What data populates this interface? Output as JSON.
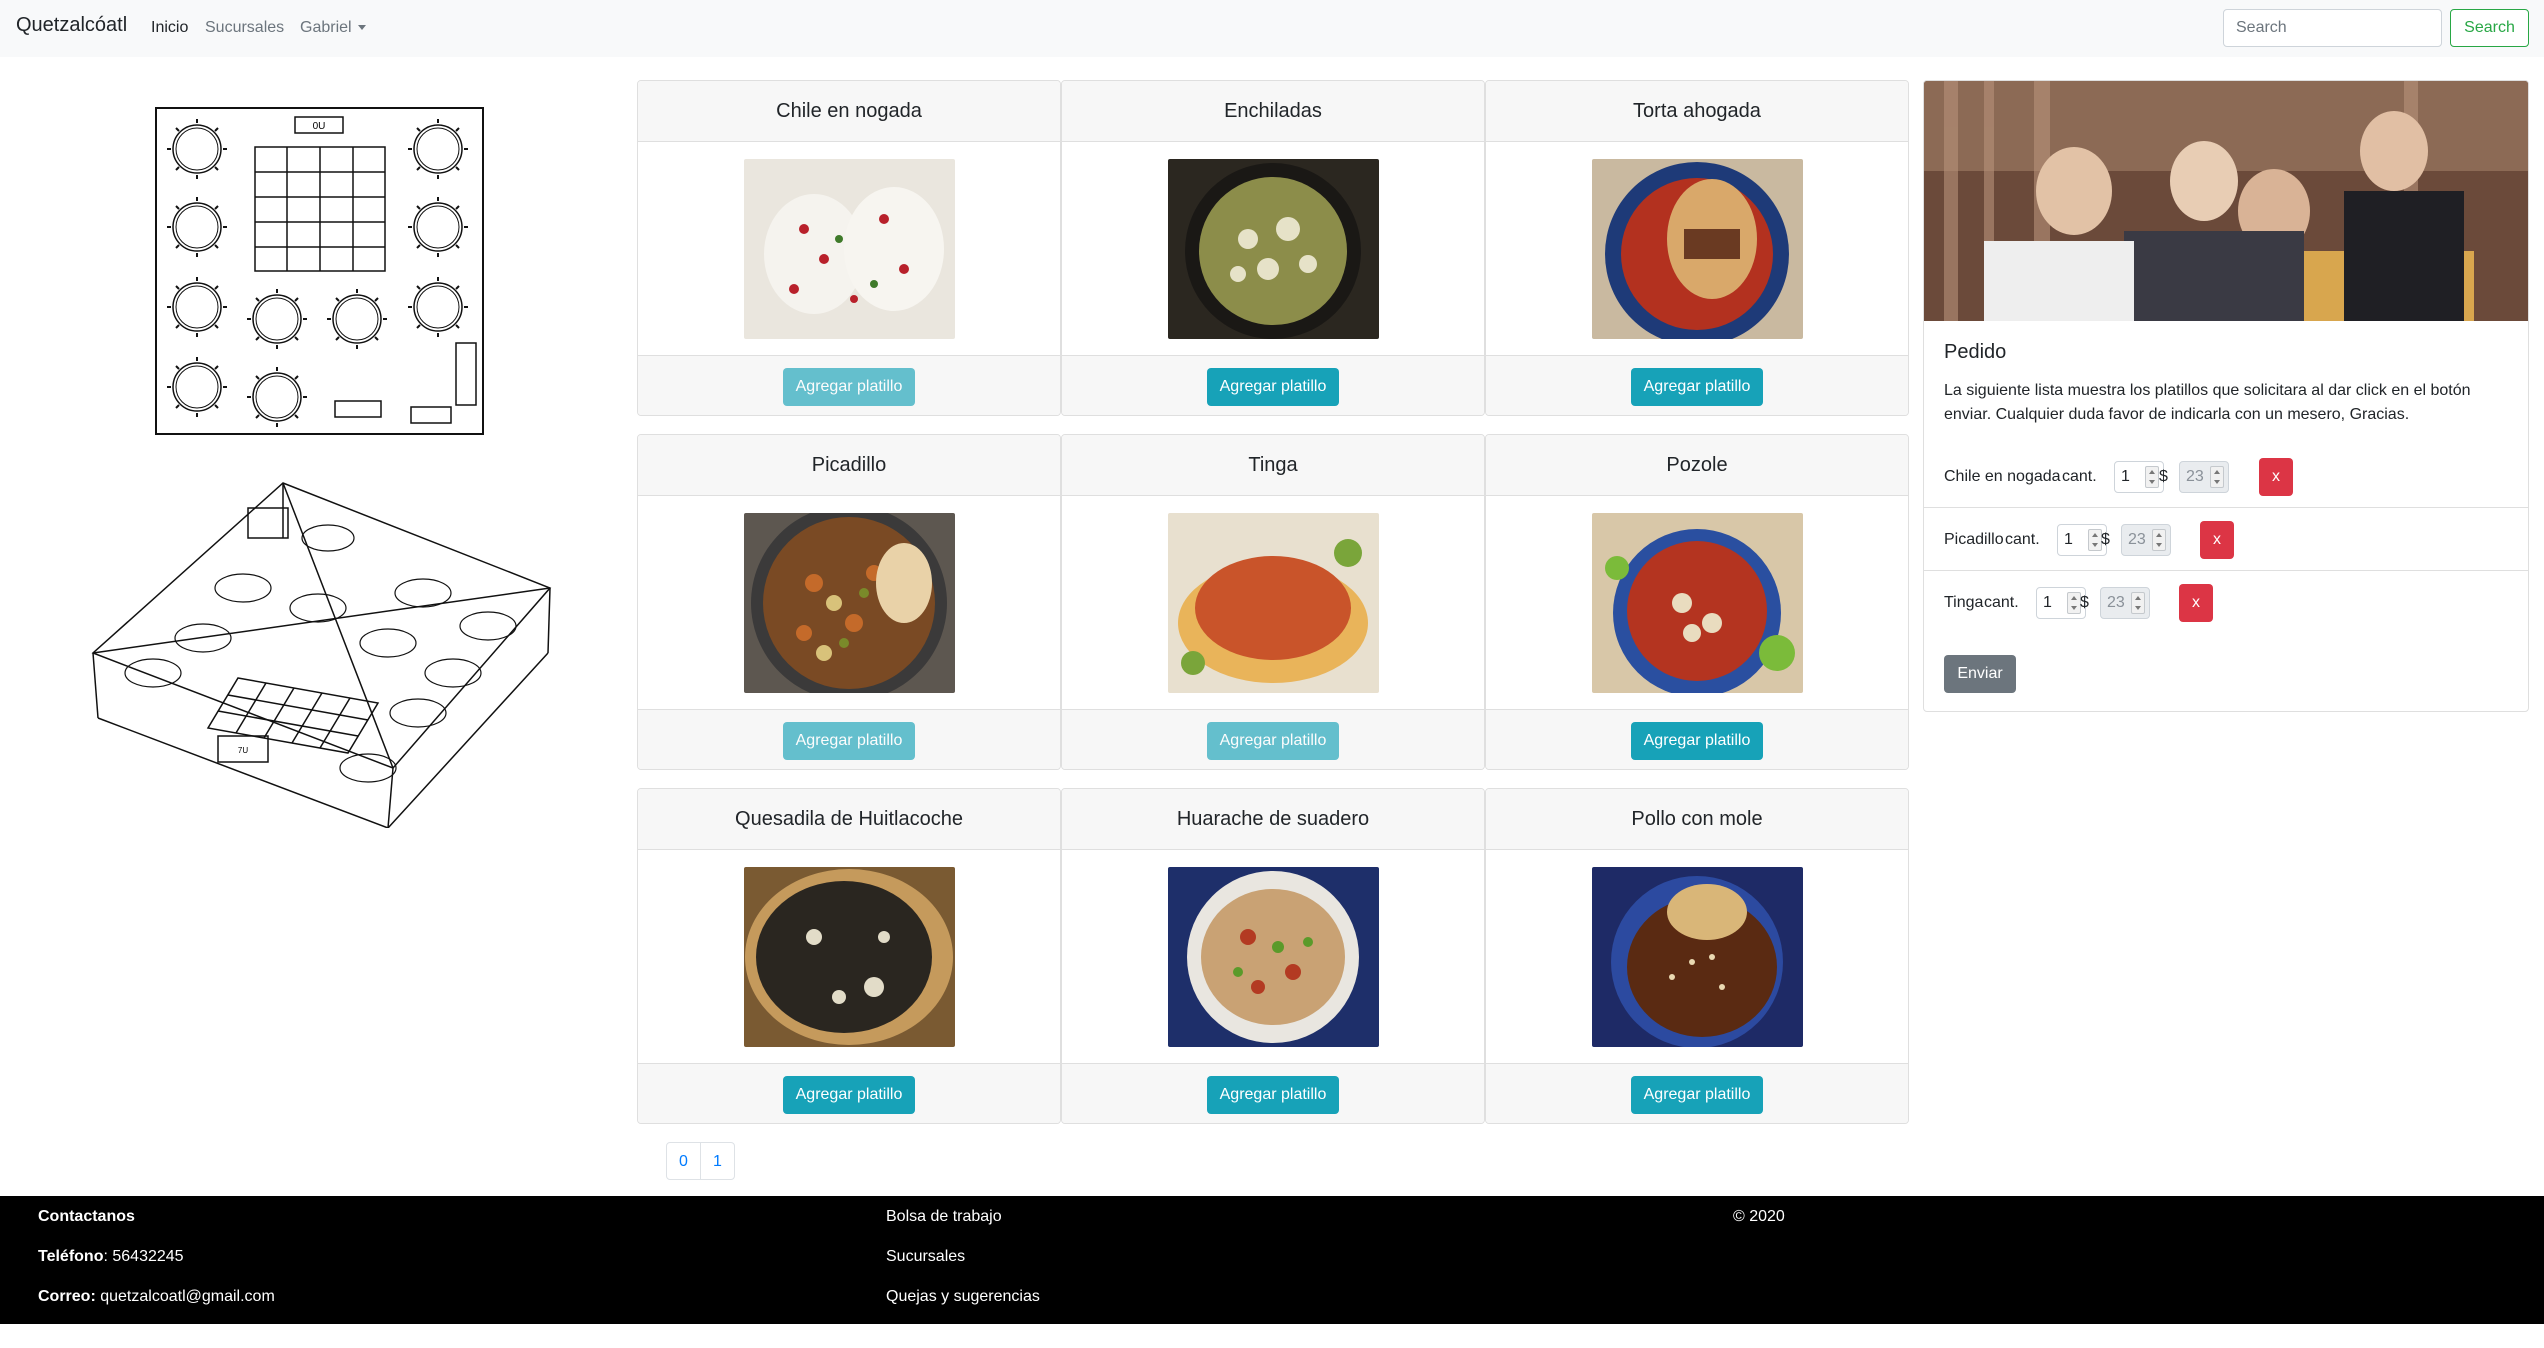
{
  "navbar": {
    "brand": "Quetzalcóatl",
    "links": [
      "Inicio",
      "Sucursales",
      "Gabriel"
    ],
    "search_placeholder": "Search",
    "search_button": "Search"
  },
  "drawings": {
    "plan_label": "0U",
    "stage_label": "7U"
  },
  "dishes": [
    {
      "name": "Chile en nogada",
      "button": "Agregar platillo",
      "disabled": true
    },
    {
      "name": "Enchiladas",
      "button": "Agregar platillo",
      "disabled": false
    },
    {
      "name": "Torta ahogada",
      "button": "Agregar platillo",
      "disabled": false
    },
    {
      "name": "Picadillo",
      "button": "Agregar platillo",
      "disabled": true
    },
    {
      "name": "Tinga",
      "button": "Agregar platillo",
      "disabled": true
    },
    {
      "name": "Pozole",
      "button": "Agregar platillo",
      "disabled": false
    },
    {
      "name": "Quesadila de Huitlacoche",
      "button": "Agregar platillo",
      "disabled": false
    },
    {
      "name": "Huarache de suadero",
      "button": "Agregar platillo",
      "disabled": false
    },
    {
      "name": "Pollo con mole",
      "button": "Agregar platillo",
      "disabled": false
    }
  ],
  "pagination": [
    "0",
    "1"
  ],
  "order": {
    "title": "Pedido",
    "description": "La siguiente lista muestra los platillos que solicitara al dar click en el botón enviar. Cualquier duda favor de indicarla con un mesero, Gracias.",
    "qty_label": "cant.",
    "price_symbol": "$",
    "items": [
      {
        "name": "Chile en nogada",
        "qty": "1",
        "price": "23",
        "remove": "x"
      },
      {
        "name": "Picadillo",
        "qty": "1",
        "price": "23",
        "remove": "x"
      },
      {
        "name": "Tinga",
        "qty": "1",
        "price": "23",
        "remove": "x"
      }
    ],
    "send_button": "Enviar"
  },
  "footer": {
    "contact_title": "Contactanos",
    "phone_label": "Teléfono",
    "phone": "56432245",
    "email_label": "Correo:",
    "email": "quetzalcoatl@gmail.com",
    "links": [
      "Bolsa de trabajo",
      "Sucursales",
      "Quejas y sugerencias"
    ],
    "copyright": "© 2020"
  },
  "colors": {
    "info": "#17a2b8",
    "danger": "#dc3545",
    "success": "#28a745",
    "secondary": "#6c757d",
    "link": "#007bff"
  }
}
